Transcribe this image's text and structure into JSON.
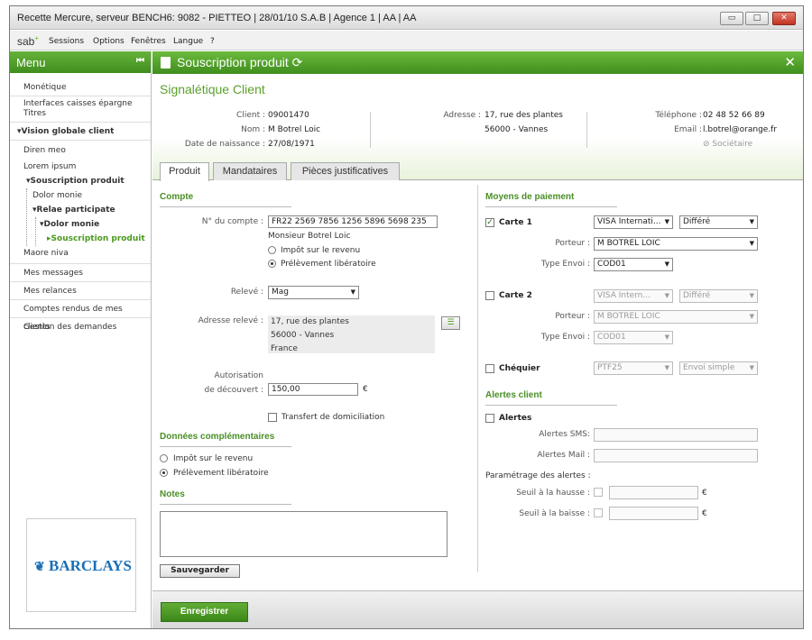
{
  "window": {
    "title": "Recette Mercure, serveur BENCH6: 9082 - PIETTEO | 28/01/10 S.A.B | Agence 1 | AA | AA",
    "min": "▭",
    "max": "□",
    "close": "✕"
  },
  "menubar": {
    "logo": "sab",
    "logo_sup": "+",
    "items": [
      "Sessions",
      "Options",
      "Fenêtres",
      "Langue",
      "?"
    ]
  },
  "sidebar": {
    "title": "Menu",
    "collapse_icon": "⏮",
    "items": [
      "Monétique",
      "Interfaces caisses épargne Titres",
      "Vision globale client",
      "Diren meo",
      "Lorem ipsum",
      "Souscription produit",
      "Dolor monie",
      "Relae participate",
      "Dolor monie",
      "Souscription produit",
      "Maore niva",
      "Mes messages",
      "Mes relances",
      "Comptes rendus de mes clients",
      "Gestion des demandes"
    ],
    "logo": "BARCLAYS"
  },
  "panel": {
    "title": "Souscription produit",
    "refresh_icon": "⟳",
    "close": "✕"
  },
  "client": {
    "title": "Signalétique Client",
    "client_label": "Client :",
    "client_value": "09001470",
    "nom_label": "Nom :",
    "nom_value": "M Botrel Loic",
    "dob_label": "Date de naissance :",
    "dob_value": "27/08/1971",
    "adresse_label": "Adresse :",
    "adresse_line1": "17, rue des plantes",
    "adresse_line2": "56000 - Vannes",
    "tel_label": "Téléphone :",
    "tel_value": "02 48 52 66 89",
    "email_label": "Email :",
    "email_value": "l.botrel@orange.fr",
    "societaire": "Sociétaire"
  },
  "tabs": [
    "Produit",
    "Mandataires",
    "Pièces justificatives"
  ],
  "compte": {
    "section": "Compte",
    "num_label": "N° du compte :",
    "num_value": "FR22 2569 7856 1256 5896 5698 235",
    "holder": "Monsieur Botrel Loic",
    "opt1": "Impôt sur le revenu",
    "opt2": "Prélèvement libératoire",
    "releve_label": "Relevé :",
    "releve_value": "Mag",
    "adresse_label": "Adresse relevé :",
    "adresse_lines": [
      "17, rue des plantes",
      "56000 - Vannes",
      "France"
    ],
    "autorisation_label1": "Autorisation",
    "autorisation_label2": "de découvert :",
    "autorisation_value": "150,00",
    "currency": "€",
    "transfert": "Transfert de domiciliation"
  },
  "donnees": {
    "section": "Données complémentaires",
    "opt1": "Impôt sur le revenu",
    "opt2": "Prélèvement libératoire"
  },
  "notes": {
    "section": "Notes",
    "save_btn": "Sauvegarder"
  },
  "paiement": {
    "section": "Moyens de paiement",
    "carte1": {
      "label": "Carte 1",
      "type": "VISA Internati...",
      "mode": "Différé",
      "porteur_label": "Porteur :",
      "porteur": "M BOTREL LOIC",
      "envoi_label": "Type Envoi :",
      "envoi": "COD01"
    },
    "carte2": {
      "label": "Carte 2",
      "type": "VISA Intern...",
      "mode": "Différé",
      "porteur_label": "Porteur :",
      "porteur": "M BOTREL LOIC",
      "envoi_label": "Type Envoi :",
      "envoi": "COD01"
    },
    "chequier": {
      "label": "Chéquier",
      "type": "PTF25",
      "mode": "Envoi simple"
    }
  },
  "alertes": {
    "section": "Alertes client",
    "label": "Alertes",
    "sms_label": "Alertes SMS:",
    "mail_label": "Alertes Mail :",
    "param_label": "Paramétrage des alertes :",
    "hausse_label": "Seuil à la hausse :",
    "baisse_label": "Seuil à la baisse :",
    "currency": "€"
  },
  "footer": {
    "save": "Enregistrer"
  }
}
